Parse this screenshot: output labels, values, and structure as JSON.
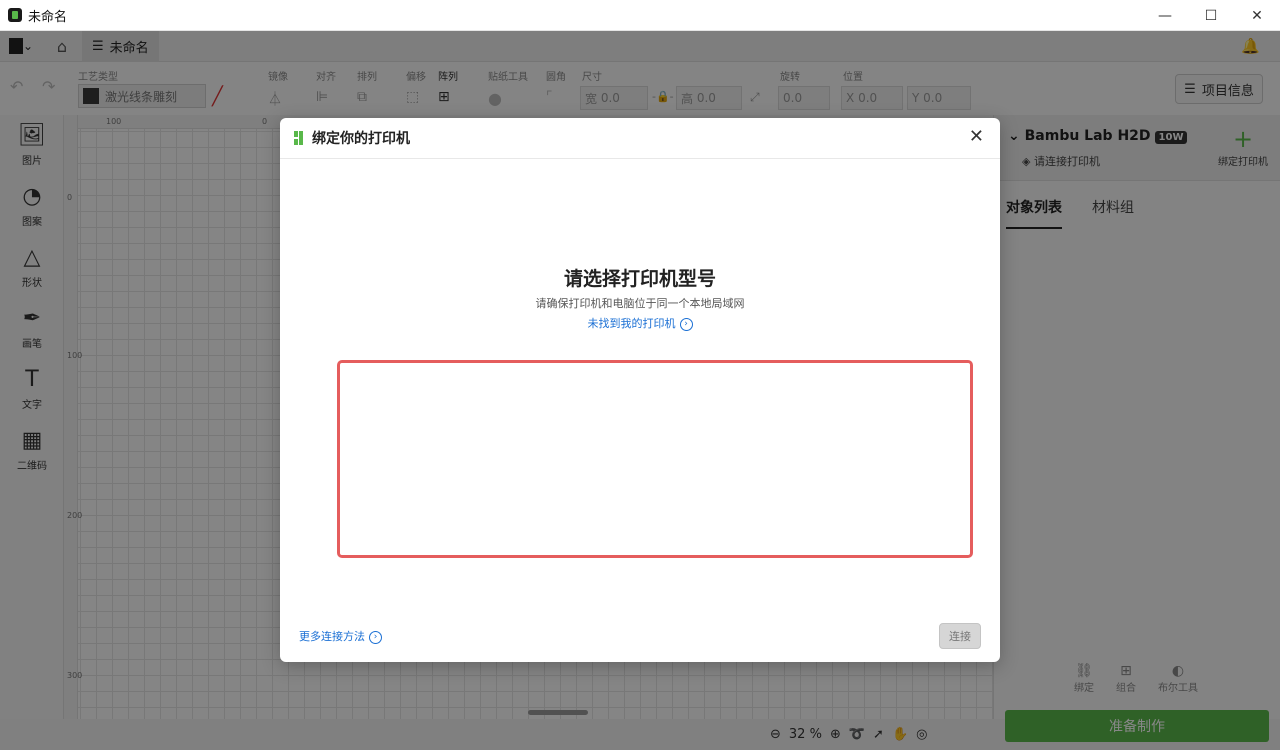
{
  "window": {
    "title": "未命名",
    "minimize": "—",
    "maximize": "☐",
    "close": "✕"
  },
  "nav": {
    "tab_label": "未命名"
  },
  "toolbar": {
    "process_type_label": "工艺类型",
    "process_type_value": "激光线条雕刻",
    "mirror_label": "镜像",
    "align_label": "对齐",
    "arrange_label": "排列",
    "offset_label": "偏移",
    "array_label": "阵列",
    "sticker_label": "贴纸工具",
    "corner_label": "圆角",
    "size_label": "尺寸",
    "width_prefix": "宽",
    "width_value": "0.0",
    "height_prefix": "高",
    "height_value": "0.0",
    "rotate_label": "旋转",
    "rotate_value": "0.0",
    "position_label": "位置",
    "x_prefix": "X",
    "x_value": "0.0",
    "y_prefix": "Y",
    "y_value": "0.0",
    "project_info": "项目信息"
  },
  "tools": [
    {
      "label": "图片",
      "icon": "image-icon"
    },
    {
      "label": "图案",
      "icon": "sticker-icon"
    },
    {
      "label": "形状",
      "icon": "shapes-icon"
    },
    {
      "label": "画笔",
      "icon": "pen-icon"
    },
    {
      "label": "文字",
      "icon": "text-icon"
    },
    {
      "label": "二维码",
      "icon": "qr-code-icon"
    }
  ],
  "ruler": {
    "top": [
      "100",
      "0"
    ],
    "left": [
      "0",
      "100",
      "200",
      "300"
    ]
  },
  "zoom": {
    "value": "32 %"
  },
  "right_panel": {
    "printer_name": "Bambu Lab H2D",
    "printer_badge": "10W",
    "printer_status": "请连接打印机",
    "bind_printer": "绑定打印机",
    "tabs": [
      "对象列表",
      "材料组"
    ],
    "actions": [
      "绑定",
      "组合",
      "布尔工具"
    ],
    "prepare_button": "准备制作"
  },
  "dialog": {
    "title": "绑定你的打印机",
    "heading": "请选择打印机型号",
    "subtitle": "请确保打印机和电脑位于同一个本地局域网",
    "not_found_link": "未找到我的打印机",
    "more_methods_link": "更多连接方法",
    "connect_button": "连接"
  },
  "colors": {
    "accent_green": "#59b84a",
    "link_blue": "#1a6fd4",
    "highlight_red": "#e55d5d"
  }
}
